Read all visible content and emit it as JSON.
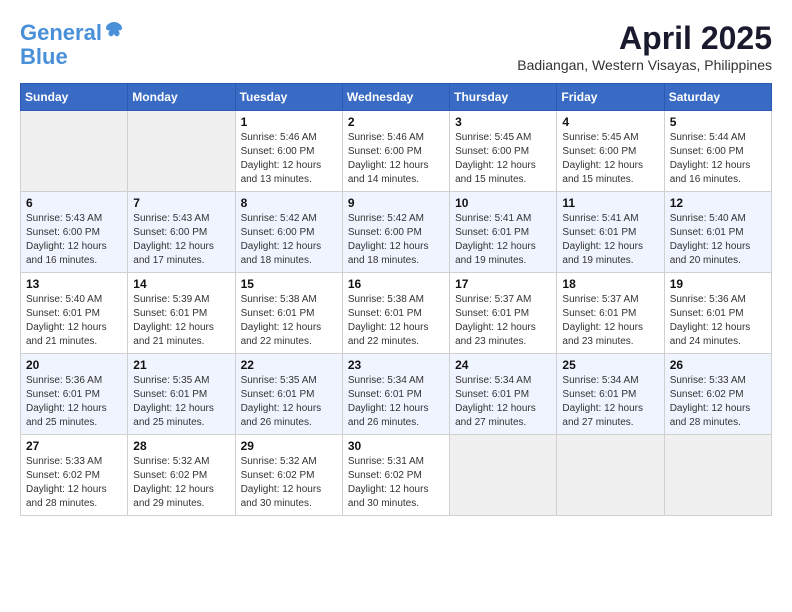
{
  "header": {
    "logo_line1": "General",
    "logo_line2": "Blue",
    "month_year": "April 2025",
    "location": "Badiangan, Western Visayas, Philippines"
  },
  "weekdays": [
    "Sunday",
    "Monday",
    "Tuesday",
    "Wednesday",
    "Thursday",
    "Friday",
    "Saturday"
  ],
  "weeks": [
    [
      {
        "day": "",
        "info": ""
      },
      {
        "day": "",
        "info": ""
      },
      {
        "day": "1",
        "info": "Sunrise: 5:46 AM\nSunset: 6:00 PM\nDaylight: 12 hours\nand 13 minutes."
      },
      {
        "day": "2",
        "info": "Sunrise: 5:46 AM\nSunset: 6:00 PM\nDaylight: 12 hours\nand 14 minutes."
      },
      {
        "day": "3",
        "info": "Sunrise: 5:45 AM\nSunset: 6:00 PM\nDaylight: 12 hours\nand 15 minutes."
      },
      {
        "day": "4",
        "info": "Sunrise: 5:45 AM\nSunset: 6:00 PM\nDaylight: 12 hours\nand 15 minutes."
      },
      {
        "day": "5",
        "info": "Sunrise: 5:44 AM\nSunset: 6:00 PM\nDaylight: 12 hours\nand 16 minutes."
      }
    ],
    [
      {
        "day": "6",
        "info": "Sunrise: 5:43 AM\nSunset: 6:00 PM\nDaylight: 12 hours\nand 16 minutes."
      },
      {
        "day": "7",
        "info": "Sunrise: 5:43 AM\nSunset: 6:00 PM\nDaylight: 12 hours\nand 17 minutes."
      },
      {
        "day": "8",
        "info": "Sunrise: 5:42 AM\nSunset: 6:00 PM\nDaylight: 12 hours\nand 18 minutes."
      },
      {
        "day": "9",
        "info": "Sunrise: 5:42 AM\nSunset: 6:00 PM\nDaylight: 12 hours\nand 18 minutes."
      },
      {
        "day": "10",
        "info": "Sunrise: 5:41 AM\nSunset: 6:01 PM\nDaylight: 12 hours\nand 19 minutes."
      },
      {
        "day": "11",
        "info": "Sunrise: 5:41 AM\nSunset: 6:01 PM\nDaylight: 12 hours\nand 19 minutes."
      },
      {
        "day": "12",
        "info": "Sunrise: 5:40 AM\nSunset: 6:01 PM\nDaylight: 12 hours\nand 20 minutes."
      }
    ],
    [
      {
        "day": "13",
        "info": "Sunrise: 5:40 AM\nSunset: 6:01 PM\nDaylight: 12 hours\nand 21 minutes."
      },
      {
        "day": "14",
        "info": "Sunrise: 5:39 AM\nSunset: 6:01 PM\nDaylight: 12 hours\nand 21 minutes."
      },
      {
        "day": "15",
        "info": "Sunrise: 5:38 AM\nSunset: 6:01 PM\nDaylight: 12 hours\nand 22 minutes."
      },
      {
        "day": "16",
        "info": "Sunrise: 5:38 AM\nSunset: 6:01 PM\nDaylight: 12 hours\nand 22 minutes."
      },
      {
        "day": "17",
        "info": "Sunrise: 5:37 AM\nSunset: 6:01 PM\nDaylight: 12 hours\nand 23 minutes."
      },
      {
        "day": "18",
        "info": "Sunrise: 5:37 AM\nSunset: 6:01 PM\nDaylight: 12 hours\nand 23 minutes."
      },
      {
        "day": "19",
        "info": "Sunrise: 5:36 AM\nSunset: 6:01 PM\nDaylight: 12 hours\nand 24 minutes."
      }
    ],
    [
      {
        "day": "20",
        "info": "Sunrise: 5:36 AM\nSunset: 6:01 PM\nDaylight: 12 hours\nand 25 minutes."
      },
      {
        "day": "21",
        "info": "Sunrise: 5:35 AM\nSunset: 6:01 PM\nDaylight: 12 hours\nand 25 minutes."
      },
      {
        "day": "22",
        "info": "Sunrise: 5:35 AM\nSunset: 6:01 PM\nDaylight: 12 hours\nand 26 minutes."
      },
      {
        "day": "23",
        "info": "Sunrise: 5:34 AM\nSunset: 6:01 PM\nDaylight: 12 hours\nand 26 minutes."
      },
      {
        "day": "24",
        "info": "Sunrise: 5:34 AM\nSunset: 6:01 PM\nDaylight: 12 hours\nand 27 minutes."
      },
      {
        "day": "25",
        "info": "Sunrise: 5:34 AM\nSunset: 6:01 PM\nDaylight: 12 hours\nand 27 minutes."
      },
      {
        "day": "26",
        "info": "Sunrise: 5:33 AM\nSunset: 6:02 PM\nDaylight: 12 hours\nand 28 minutes."
      }
    ],
    [
      {
        "day": "27",
        "info": "Sunrise: 5:33 AM\nSunset: 6:02 PM\nDaylight: 12 hours\nand 28 minutes."
      },
      {
        "day": "28",
        "info": "Sunrise: 5:32 AM\nSunset: 6:02 PM\nDaylight: 12 hours\nand 29 minutes."
      },
      {
        "day": "29",
        "info": "Sunrise: 5:32 AM\nSunset: 6:02 PM\nDaylight: 12 hours\nand 30 minutes."
      },
      {
        "day": "30",
        "info": "Sunrise: 5:31 AM\nSunset: 6:02 PM\nDaylight: 12 hours\nand 30 minutes."
      },
      {
        "day": "",
        "info": ""
      },
      {
        "day": "",
        "info": ""
      },
      {
        "day": "",
        "info": ""
      }
    ]
  ]
}
